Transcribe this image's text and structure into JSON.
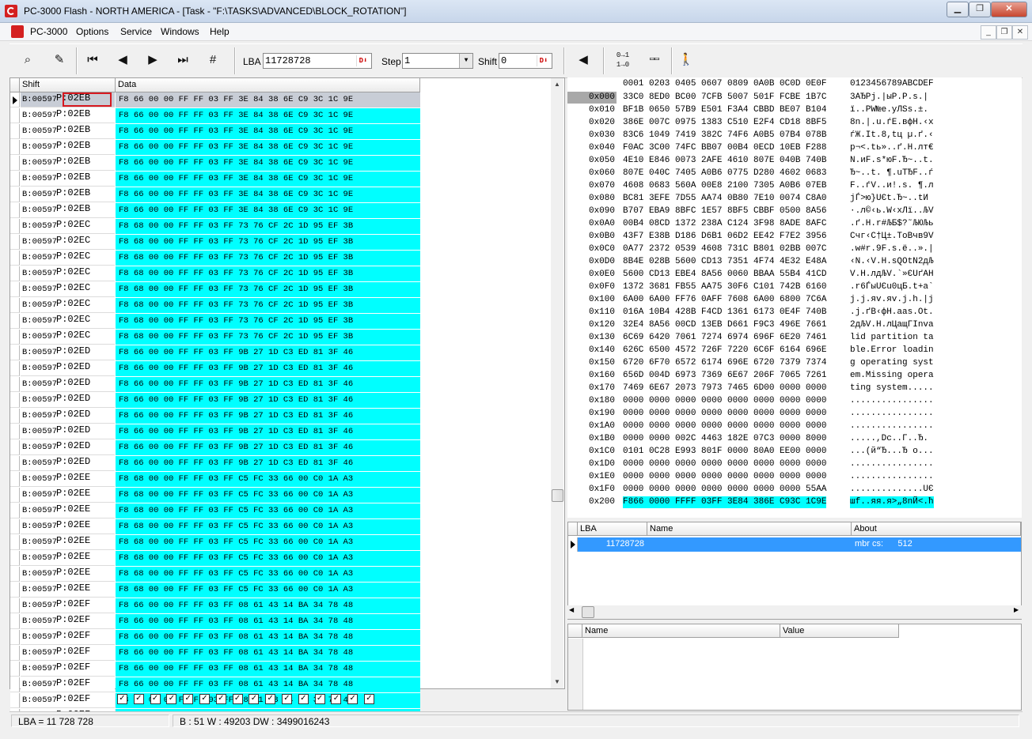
{
  "window": {
    "title": "PC-3000 Flash  - NORTH AMERICA - [Task - \"F:\\TASKS\\ADVANCED\\BLOCK_ROTATION\"]"
  },
  "menu": [
    "PC-3000",
    "Options",
    "Service",
    "Windows",
    "Help"
  ],
  "toolbar": {
    "lba_label": "LBA",
    "lba_value": "11728728",
    "step_label": "Step",
    "step_value": "1",
    "shift_label": "Shift",
    "shift_value": "0"
  },
  "grid": {
    "col_shift": "Shift",
    "col_data": "Data",
    "rows": [
      [
        "B:00597",
        "P:02EB",
        "F8 66 00 00 FF FF 03 FF 3E 84 38 6E C9 3C 1C 9E"
      ],
      [
        "B:00597",
        "P:02EB",
        "F8 66 00 00 FF FF 03 FF 3E 84 38 6E C9 3C 1C 9E"
      ],
      [
        "B:00597",
        "P:02EB",
        "F8 66 00 00 FF FF 03 FF 3E 84 38 6E C9 3C 1C 9E"
      ],
      [
        "B:00597",
        "P:02EB",
        "F8 66 00 00 FF FF 03 FF 3E 84 38 6E C9 3C 1C 9E"
      ],
      [
        "B:00597",
        "P:02EB",
        "F8 66 00 00 FF FF 03 FF 3E 84 38 6E C9 3C 1C 9E"
      ],
      [
        "B:00597",
        "P:02EB",
        "F8 66 00 00 FF FF 03 FF 3E 84 38 6E C9 3C 1C 9E"
      ],
      [
        "B:00597",
        "P:02EB",
        "F8 66 00 00 FF FF 03 FF 3E 84 38 6E C9 3C 1C 9E"
      ],
      [
        "B:00597",
        "P:02EB",
        "F8 66 00 00 FF FF 03 FF 3E 84 38 6E C9 3C 1C 9E"
      ],
      [
        "B:00597",
        "P:02EC",
        "F8 68 00 00 FF FF 03 FF 73 76 CF 2C 1D 95 EF 3B"
      ],
      [
        "B:00597",
        "P:02EC",
        "F8 68 00 00 FF FF 03 FF 73 76 CF 2C 1D 95 EF 3B"
      ],
      [
        "B:00597",
        "P:02EC",
        "F8 68 00 00 FF FF 03 FF 73 76 CF 2C 1D 95 EF 3B"
      ],
      [
        "B:00597",
        "P:02EC",
        "F8 68 00 00 FF FF 03 FF 73 76 CF 2C 1D 95 EF 3B"
      ],
      [
        "B:00597",
        "P:02EC",
        "F8 68 00 00 FF FF 03 FF 73 76 CF 2C 1D 95 EF 3B"
      ],
      [
        "B:00597",
        "P:02EC",
        "F8 68 00 00 FF FF 03 FF 73 76 CF 2C 1D 95 EF 3B"
      ],
      [
        "B:00597",
        "P:02EC",
        "F8 68 00 00 FF FF 03 FF 73 76 CF 2C 1D 95 EF 3B"
      ],
      [
        "B:00597",
        "P:02EC",
        "F8 68 00 00 FF FF 03 FF 73 76 CF 2C 1D 95 EF 3B"
      ],
      [
        "B:00597",
        "P:02ED",
        "F8 66 00 00 FF FF 03 FF 9B 27 1D C3 ED 81 3F 46"
      ],
      [
        "B:00597",
        "P:02ED",
        "F8 66 00 00 FF FF 03 FF 9B 27 1D C3 ED 81 3F 46"
      ],
      [
        "B:00597",
        "P:02ED",
        "F8 66 00 00 FF FF 03 FF 9B 27 1D C3 ED 81 3F 46"
      ],
      [
        "B:00597",
        "P:02ED",
        "F8 66 00 00 FF FF 03 FF 9B 27 1D C3 ED 81 3F 46"
      ],
      [
        "B:00597",
        "P:02ED",
        "F8 66 00 00 FF FF 03 FF 9B 27 1D C3 ED 81 3F 46"
      ],
      [
        "B:00597",
        "P:02ED",
        "F8 66 00 00 FF FF 03 FF 9B 27 1D C3 ED 81 3F 46"
      ],
      [
        "B:00597",
        "P:02ED",
        "F8 66 00 00 FF FF 03 FF 9B 27 1D C3 ED 81 3F 46"
      ],
      [
        "B:00597",
        "P:02ED",
        "F8 66 00 00 FF FF 03 FF 9B 27 1D C3 ED 81 3F 46"
      ],
      [
        "B:00597",
        "P:02EE",
        "F8 68 00 00 FF FF 03 FF C5 FC 33 66 00 C0 1A A3"
      ],
      [
        "B:00597",
        "P:02EE",
        "F8 68 00 00 FF FF 03 FF C5 FC 33 66 00 C0 1A A3"
      ],
      [
        "B:00597",
        "P:02EE",
        "F8 68 00 00 FF FF 03 FF C5 FC 33 66 00 C0 1A A3"
      ],
      [
        "B:00597",
        "P:02EE",
        "F8 68 00 00 FF FF 03 FF C5 FC 33 66 00 C0 1A A3"
      ],
      [
        "B:00597",
        "P:02EE",
        "F8 68 00 00 FF FF 03 FF C5 FC 33 66 00 C0 1A A3"
      ],
      [
        "B:00597",
        "P:02EE",
        "F8 68 00 00 FF FF 03 FF C5 FC 33 66 00 C0 1A A3"
      ],
      [
        "B:00597",
        "P:02EE",
        "F8 68 00 00 FF FF 03 FF C5 FC 33 66 00 C0 1A A3"
      ],
      [
        "B:00597",
        "P:02EE",
        "F8 68 00 00 FF FF 03 FF C5 FC 33 66 00 C0 1A A3"
      ],
      [
        "B:00597",
        "P:02EF",
        "F8 66 00 00 FF FF 03 FF 08 61 43 14 BA 34 78 48"
      ],
      [
        "B:00597",
        "P:02EF",
        "F8 66 00 00 FF FF 03 FF 08 61 43 14 BA 34 78 48"
      ],
      [
        "B:00597",
        "P:02EF",
        "F8 66 00 00 FF FF 03 FF 08 61 43 14 BA 34 78 48"
      ],
      [
        "B:00597",
        "P:02EF",
        "F8 66 00 00 FF FF 03 FF 08 61 43 14 BA 34 78 48"
      ],
      [
        "B:00597",
        "P:02EF",
        "F8 66 00 00 FF FF 03 FF 08 61 43 14 BA 34 78 48"
      ],
      [
        "B:00597",
        "P:02EF",
        "F8 66 00 00 FF FF 03 FF 08 61 43 14 BA 34 78 48"
      ],
      [
        "B:00597",
        "P:02EF",
        "F8 66 00 00 FF FF 03 FF 08 61 43 14 BA 34 78 48"
      ],
      [
        "B:00597",
        "P:02EF",
        "F8 66 00 00 FF FF 03 FF 08 61 43 14 BA 34 78 48"
      ]
    ]
  },
  "hexview": {
    "header_hex": "0001 0203 0405 0607 0809 0A0B 0C0D 0E0F",
    "header_ascii": "0123456789ABCDEF",
    "rows": [
      [
        "0x000",
        "33C0 8ED0 BC00 7CFB 5007 501F FCBE 1B7C",
        "3АЂРj.|ыР.Р.ѕ.|"
      ],
      [
        "0x010",
        "BF1B 0650 57B9 E501 F3A4 CBBD BE07 B104",
        "ї..PW№е.уЛЅѕ.±."
      ],
      [
        "0x020",
        "386E 007C 0975 1383 C510 E2F4 CD18 8BF5",
        "8n.|.u.ѓЕ.вфН.‹х"
      ],
      [
        "0x030",
        "83C6 1049 7419 382C 74F6 A0B5 07B4 078B",
        "ѓЖ.It.8,tц µ.ґ.‹"
      ],
      [
        "0x040",
        "F0AC 3C00 74FC BB07 00B4 0ECD 10EB F288",
        "р¬<.tь»..ґ.Н.лт€"
      ],
      [
        "0x050",
        "4E10 E846 0073 2AFE 4610 807E 040B 740B",
        "N.иF.s*юF.Ђ~..t."
      ],
      [
        "0x060",
        "807E 040C 7405 A0B6 0775 D280 4602 0683",
        "Ђ~..t. ¶.uТЂF..ѓ"
      ],
      [
        "0x070",
        "4608 0683 560A 00E8 2100 7305 A0B6 07EB",
        "F..ѓV..и!.s. ¶.л"
      ],
      [
        "0x080",
        "BC81 3EFE 7D55 AA74 0B80 7E10 0074 C8A0",
        "јЃ>ю}UЄt.Ђ~..tИ "
      ],
      [
        "0x090",
        "B707 EBA9 8BFC 1E57 8BF5 CBBF 0500 8A56",
        "·.л©‹ь.W‹хЛї..ЉV"
      ],
      [
        "0x0A0",
        "00B4 08CD 1372 238A C124 3F98 8ADE 8AFC",
        ".ґ.Н.r#ЉБ$?˜ЉЮЉь"
      ],
      [
        "0x0B0",
        "43F7 E38B D186 D6B1 06D2 EE42 F7E2 3956",
        "Cчг‹С†Ц±.ТоBчв9V"
      ],
      [
        "0x0C0",
        "0A77 2372 0539 4608 731C B801 02BB 007C",
        ".w#r.9F.s.ё..».|"
      ],
      [
        "0x0D0",
        "8B4E 028B 5600 CD13 7351 4F74 4E32 E48A",
        "‹N.‹V.Н.sQOtN2дЉ"
      ],
      [
        "0x0E0",
        "5600 CD13 EBE4 8A56 0060 BBAA 55B4 41CD",
        "V.Н.лдЉV.`»ЄUґAН"
      ],
      [
        "0x0F0",
        "1372 3681 FB55 AA75 30F6 C101 742B 6160",
        ".r6ЃыUЄu0цБ.t+a`"
      ],
      [
        "0x100",
        "6A00 6A00 FF76 0AFF 7608 6A00 6800 7C6A",
        "j.j.яv.яv.j.h.|j"
      ],
      [
        "0x110",
        "016A 10B4 428B F4CD 1361 6173 0E4F 740B",
        ".j.ґB‹фН.aas.Ot."
      ],
      [
        "0x120",
        "32E4 8A56 00CD 13EB D661 F9C3 496E 7661",
        "2дЉV.Н.лЦaщГInva"
      ],
      [
        "0x130",
        "6C69 6420 7061 7274 6974 696F 6E20 7461",
        "lid partition ta"
      ],
      [
        "0x140",
        "626C 6500 4572 726F 7220 6C6F 6164 696E",
        "ble.Error loadin"
      ],
      [
        "0x150",
        "6720 6F70 6572 6174 696E 6720 7379 7374",
        "g operating syst"
      ],
      [
        "0x160",
        "656D 004D 6973 7369 6E67 206F 7065 7261",
        "em.Missing opera"
      ],
      [
        "0x170",
        "7469 6E67 2073 7973 7465 6D00 0000 0000",
        "ting system....."
      ],
      [
        "0x180",
        "0000 0000 0000 0000 0000 0000 0000 0000",
        "................"
      ],
      [
        "0x190",
        "0000 0000 0000 0000 0000 0000 0000 0000",
        "................"
      ],
      [
        "0x1A0",
        "0000 0000 0000 0000 0000 0000 0000 0000",
        "................"
      ],
      [
        "0x1B0",
        "0000 0000 002C 4463 182E 07C3 0000 8000",
        ".....,Dc..Г..Ђ."
      ],
      [
        "0x1C0",
        "0101 0C28 E993 801F 0000 80A0 EE00 0000",
        "...(й“Ђ...Ђ о..."
      ],
      [
        "0x1D0",
        "0000 0000 0000 0000 0000 0000 0000 0000",
        "................"
      ],
      [
        "0x1E0",
        "0000 0000 0000 0000 0000 0000 0000 0000",
        "................"
      ],
      [
        "0x1F0",
        "0000 0000 0000 0000 0000 0000 0000 55AA",
        "..............UЄ"
      ],
      [
        "0x200",
        "F866 0000 FFFF 03FF 3E84 386E C93C 1C9E",
        "шf..яя.я>„8nЙ<.ћ"
      ]
    ]
  },
  "lba_table": {
    "col_lba": "LBA",
    "col_name": "Name",
    "col_about": "About",
    "row": {
      "lba": "11728728",
      "name": "",
      "about": "mbr cs:      512"
    }
  },
  "nv_table": {
    "col_name": "Name",
    "col_value": "Value"
  },
  "status": {
    "lba": "LBA = 11 728 728",
    "info": "B : 51 W : 49203 DW : 3499016243"
  },
  "colors": {
    "highlight": "#00ffff",
    "selection": "#3399ff",
    "marker": "#d71920"
  }
}
